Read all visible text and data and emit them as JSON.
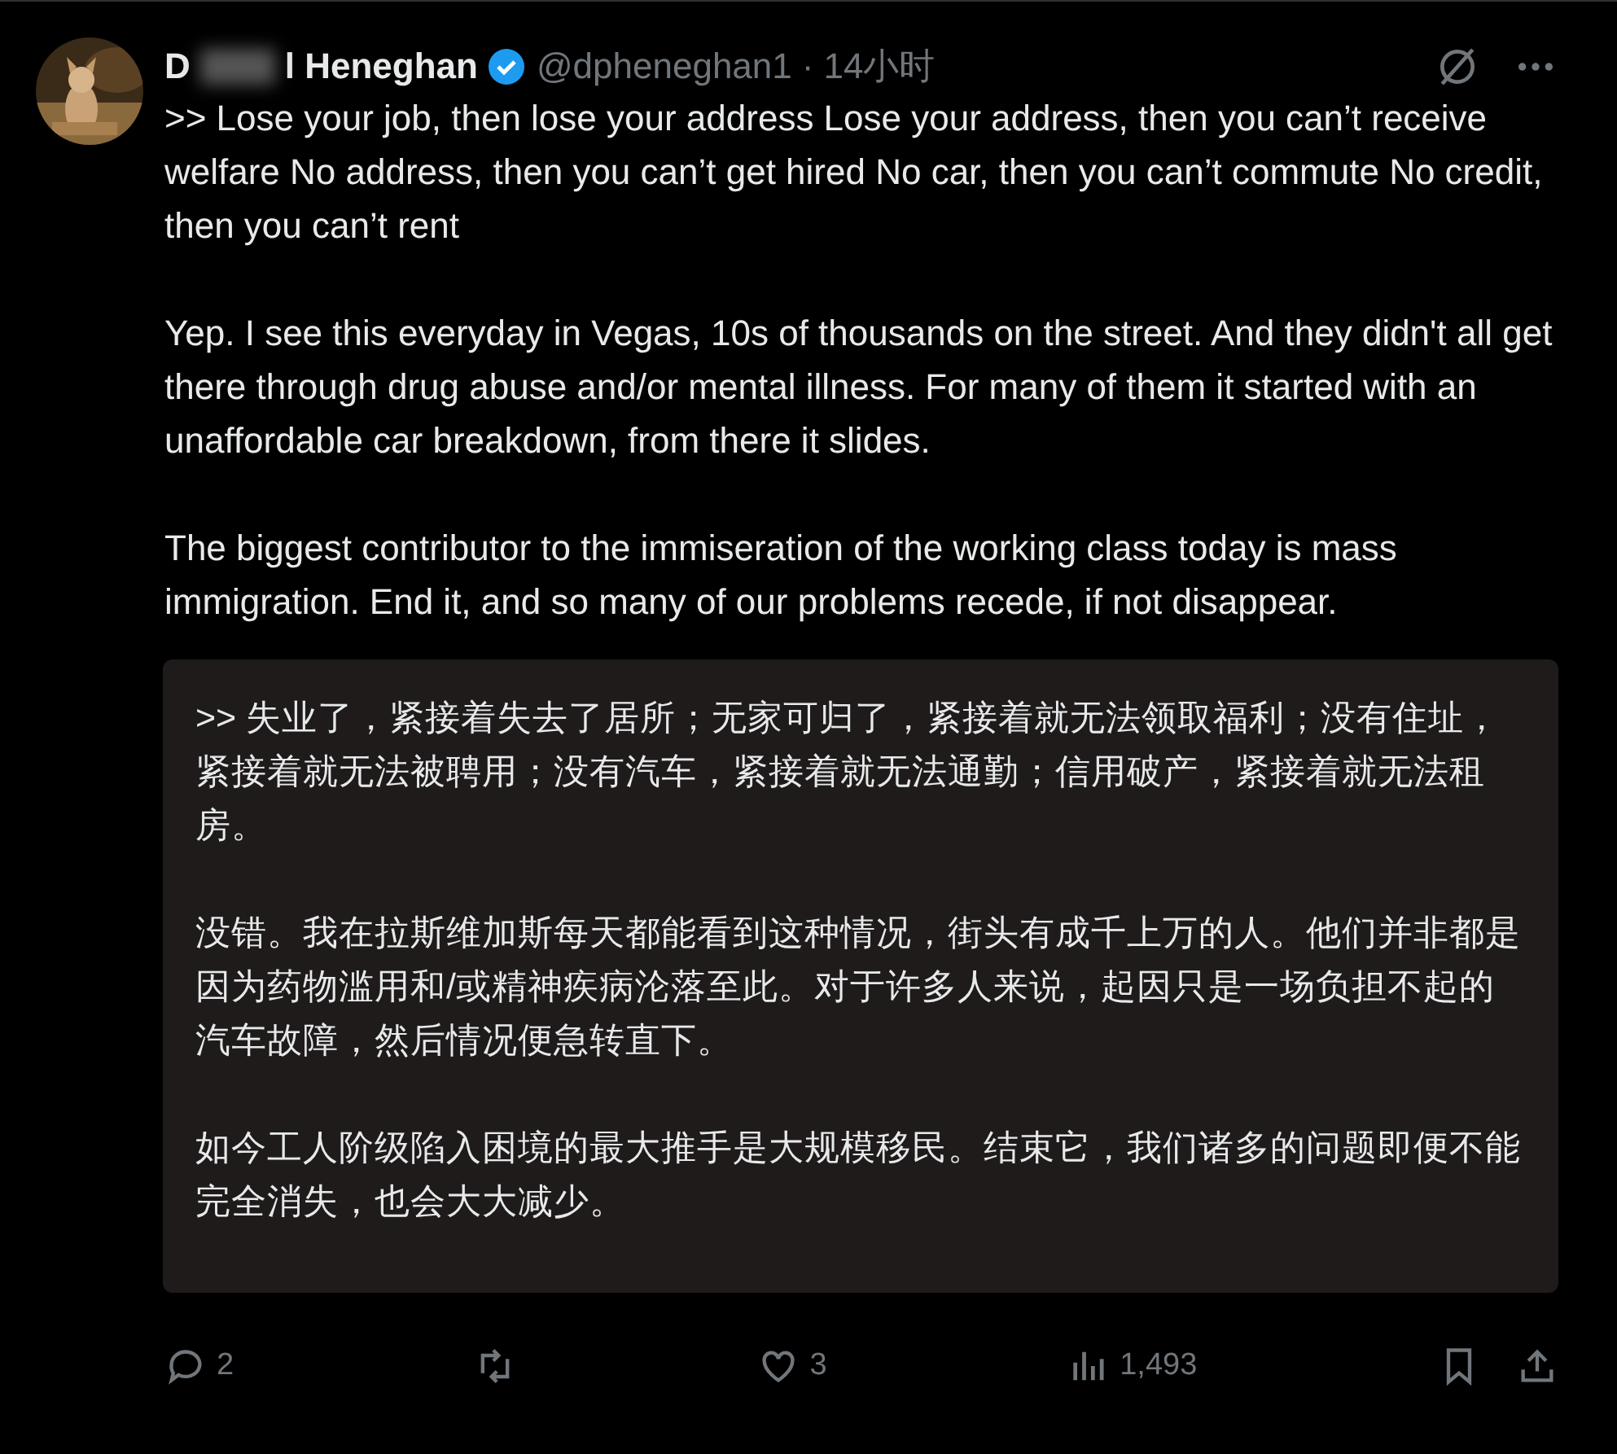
{
  "author": {
    "name_start": "D",
    "name_end": "l Heneghan",
    "verified": true,
    "handle": "@dpheneghan1",
    "separator": "·",
    "time": "14小时"
  },
  "paragraphs": [
    ">> Lose your job, then lose your address Lose your address, then you can’t receive welfare No address, then you can’t get hired No car, then you can’t commute No credit, then you can’t rent",
    "Yep. I see this everyday in Vegas, 10s of thousands on the street. And they didn't all get there through drug abuse and/or mental illness. For many of them it started with an unaffordable car breakdown, from there it slides.",
    "The biggest contributor to the immiseration of the working class today is mass immigration. End it, and so many of our problems recede, if not disappear."
  ],
  "translation": [
    ">> 失业了，紧接着失去了居所；无家可归了，紧接着就无法领取福利；没有住址，紧接着就无法被聘用；没有汽车，紧接着就无法通勤；信用破产，紧接着就无法租房。",
    "没错。我在拉斯维加斯每天都能看到这种情况，街头有成千上万的人。他们并非都是因为药物滥用和/或精神疾病沦落至此。对于许多人来说，起因只是一场负担不起的汽车故障，然后情况便急转直下。",
    "如今工人阶级陷入困境的最大推手是大规模移民。结束它，我们诸多的问题即便不能完全消失，也会大大减少。"
  ],
  "actions": [
    {
      "kind": "reply",
      "count": "2"
    },
    {
      "kind": "repost"
    },
    {
      "kind": "like",
      "count": "3"
    },
    {
      "kind": "views",
      "count": "1,493"
    },
    {
      "kind": "bookmark"
    },
    {
      "kind": "share"
    }
  ]
}
